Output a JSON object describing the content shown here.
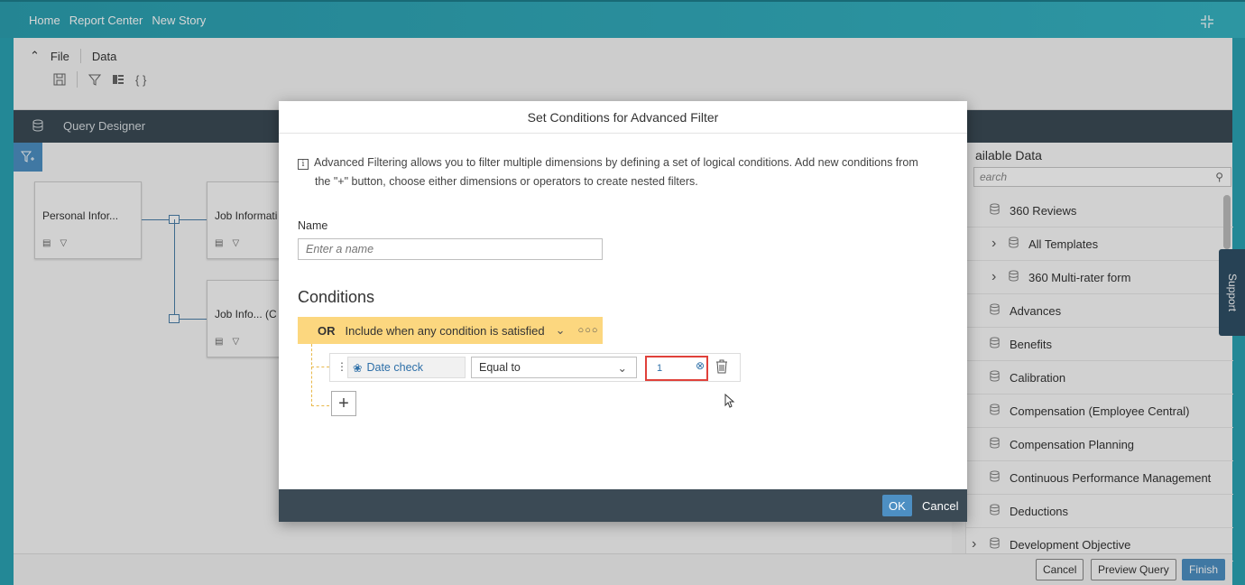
{
  "breadcrumbs": [
    "Home",
    "Report Center",
    "New Story"
  ],
  "toolbar": {
    "menu": [
      "File",
      "Data"
    ]
  },
  "query_designer": {
    "label": "Query Designer"
  },
  "nodes": [
    {
      "label": "Personal Infor..."
    },
    {
      "label": "Job Informati"
    },
    {
      "label": "Job Info... (C"
    }
  ],
  "available_data": {
    "title": "ailable Data",
    "search_placeholder": "earch",
    "items": [
      {
        "label": "360 Reviews",
        "expandable": false
      },
      {
        "label": "All Templates",
        "expandable": true
      },
      {
        "label": "360 Multi-rater form",
        "expandable": true
      },
      {
        "label": "Advances",
        "expandable": false
      },
      {
        "label": "Benefits",
        "expandable": false
      },
      {
        "label": "Calibration",
        "expandable": false
      },
      {
        "label": "Compensation (Employee Central)",
        "expandable": false
      },
      {
        "label": "Compensation Planning",
        "expandable": false
      },
      {
        "label": "Continuous Performance Management",
        "expandable": false
      },
      {
        "label": "Deductions",
        "expandable": false
      },
      {
        "label": "Development Objective",
        "expandable": true
      }
    ]
  },
  "support": "Support",
  "footer": {
    "cancel": "Cancel",
    "preview": "Preview Query",
    "finish": "Finish"
  },
  "dialog": {
    "title": "Set Conditions for Advanced Filter",
    "info_line1": "Advanced Filtering allows you to filter multiple dimensions by defining a set of logical conditions. Add new conditions from",
    "info_line2": "the \"+\" button, choose either dimensions or operators to create nested filters.",
    "name_label": "Name",
    "name_placeholder": "Enter a name",
    "conditions_title": "Conditions",
    "group_operator": "OR",
    "group_text": "Include when any condition is satisfied",
    "condition": {
      "dimension": "Date check",
      "operator": "Equal to",
      "value": "1"
    },
    "ok": "OK",
    "cancel": "Cancel"
  }
}
